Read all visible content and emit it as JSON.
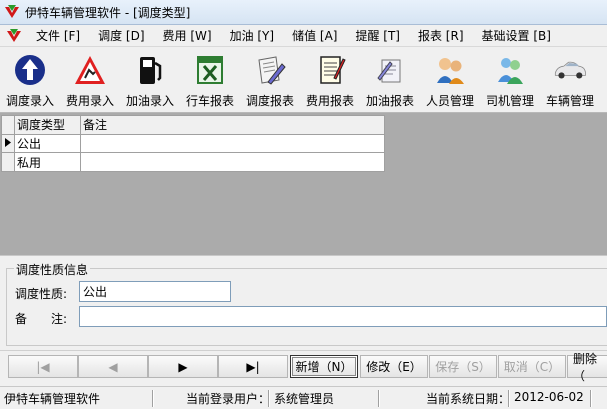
{
  "window": {
    "title": "伊特车辆管理软件 - [调度类型]"
  },
  "menu": [
    {
      "label": "文件 [F]"
    },
    {
      "label": "调度 [D]"
    },
    {
      "label": "费用 [W]"
    },
    {
      "label": "加油 [Y]"
    },
    {
      "label": "储值 [A]"
    },
    {
      "label": "提醒 [T]"
    },
    {
      "label": "报表 [R]"
    },
    {
      "label": "基础设置 [B]"
    }
  ],
  "toolbar": [
    {
      "label": "调度录入",
      "icon": "up-arrow-icon"
    },
    {
      "label": "费用录入",
      "icon": "road-work-icon"
    },
    {
      "label": "加油录入",
      "icon": "fuel-pump-icon"
    },
    {
      "label": "行车报表",
      "icon": "excel-icon"
    },
    {
      "label": "调度报表",
      "icon": "document-pen-icon"
    },
    {
      "label": "费用报表",
      "icon": "notepad-icon"
    },
    {
      "label": "加油报表",
      "icon": "report-icon"
    },
    {
      "label": "人员管理",
      "icon": "people-icon"
    },
    {
      "label": "司机管理",
      "icon": "driver-icon"
    },
    {
      "label": "车辆管理",
      "icon": "car-icon"
    }
  ],
  "grid": {
    "columns": [
      "调度类型",
      "备注"
    ],
    "rows": [
      {
        "type": "公出",
        "note": ""
      },
      {
        "type": "私用",
        "note": ""
      }
    ]
  },
  "form": {
    "group_title": "调度性质信息",
    "type_label": "调度性质:",
    "type_value": "公出",
    "note_label": "备　　注:",
    "note_value": ""
  },
  "nav": {
    "first": "|◀",
    "prev": "◀",
    "next": "▶",
    "last": "▶|",
    "add": "新增（N）",
    "edit": "修改（E）",
    "save": "保存（S）",
    "cancel": "取消（C）",
    "delete": "删除（"
  },
  "status": {
    "app_name": "伊特车辆管理软件",
    "user_label": "当前登录用户：",
    "user_value": "系统管理员",
    "date_label": "当前系统日期：",
    "date_value": "2012-06-02"
  }
}
